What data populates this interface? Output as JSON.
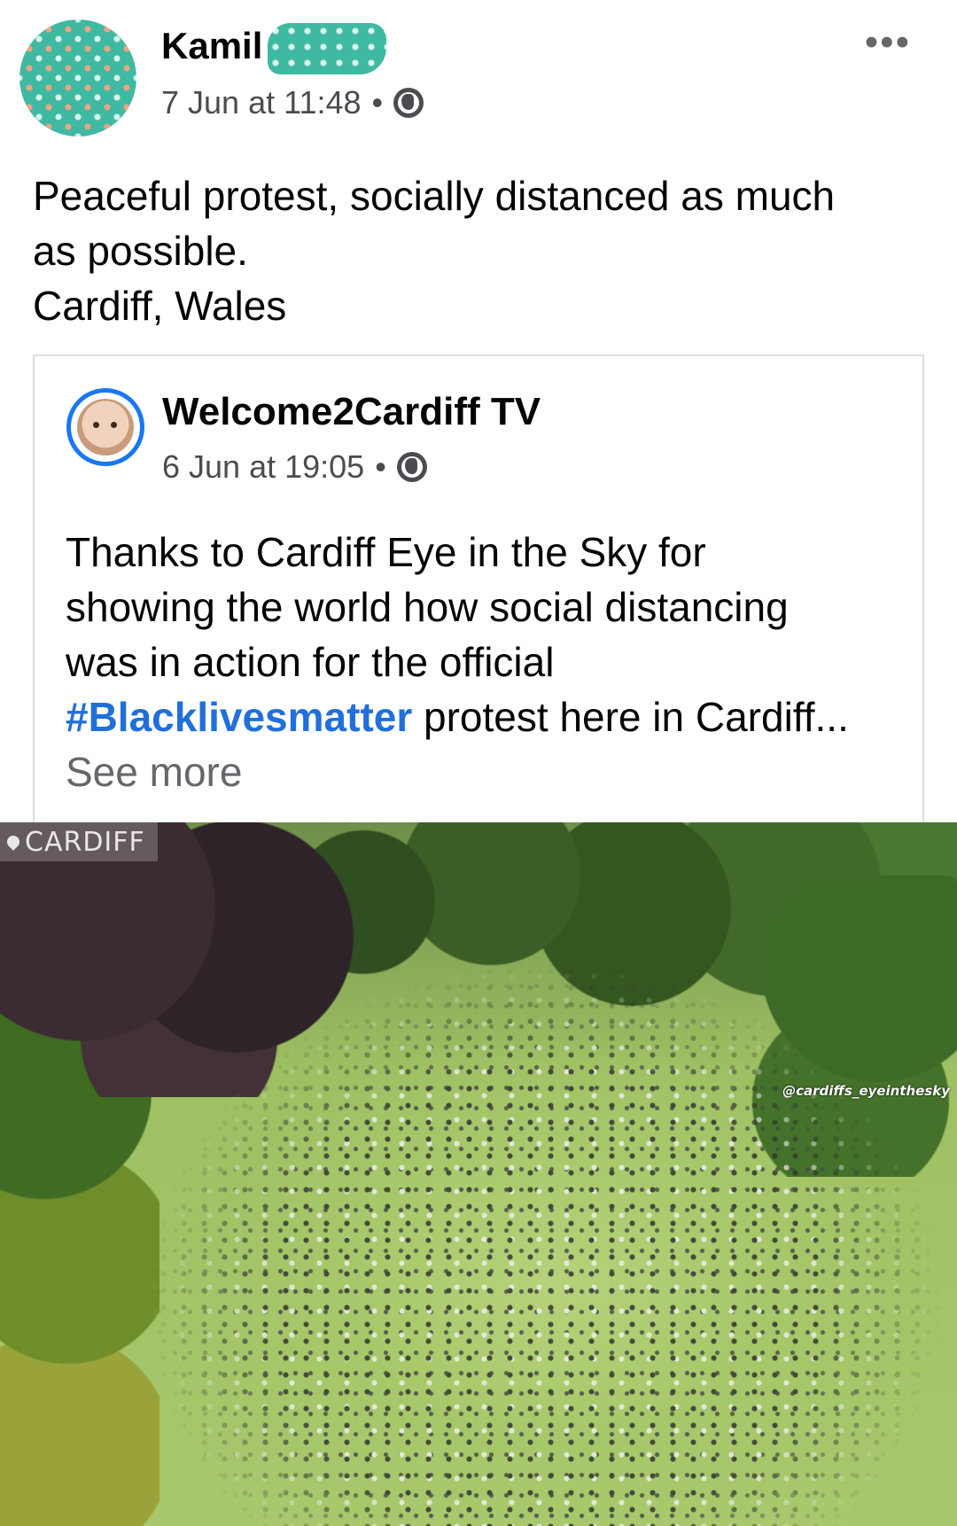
{
  "post": {
    "author": "Kamil",
    "timestamp": "7 Jun at 11:48",
    "separator": "•",
    "privacy_icon": "globe-icon",
    "more_icon": "•••",
    "text_lines": [
      "Peaceful protest,  socially distanced as much",
      "as possible.",
      "Cardiff, Wales"
    ]
  },
  "shared": {
    "author": "Welcome2Cardiff TV",
    "timestamp": "6 Jun at 19:05",
    "separator": "•",
    "privacy_icon": "globe-icon",
    "text_lines": [
      "Thanks to Cardiff Eye in the Sky for",
      "showing the world how social distancing",
      "was in action for the official"
    ],
    "hashtag": "#Blacklivesmatter",
    "last_line_rest": " protest here in Cardiff...",
    "see_more": "See more"
  },
  "photo": {
    "location_label": "CARDIFF",
    "credit": "@cardiffs_eyeinthesky"
  },
  "colors": {
    "hashtag": "#216fdb",
    "avatar_ring": "#1877f2",
    "avatar_teal": "#3fb9a2"
  }
}
